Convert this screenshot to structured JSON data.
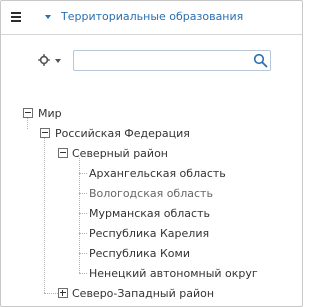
{
  "header": {
    "title": "Территориальные образования",
    "menu_icon": "hamburger-menu-icon",
    "dropdown_icon": "caret-down-icon"
  },
  "toolbar": {
    "settings_icon": "gear-icon",
    "search": {
      "value": "",
      "placeholder": "",
      "icon": "search-icon"
    }
  },
  "colors": {
    "accent": "#2a6fb0",
    "border": "#c8c8c8",
    "search_border": "#b7c7d8"
  },
  "tree": {
    "root": {
      "label": "Мир",
      "expanded": true
    },
    "country": {
      "label": "Российская Федерация",
      "expanded": true
    },
    "district1": {
      "label": "Северный район",
      "expanded": true,
      "children": [
        {
          "label": "Архангельская область"
        },
        {
          "label": "Вологодская область"
        },
        {
          "label": "Мурманская область"
        },
        {
          "label": "Республика Карелия"
        },
        {
          "label": "Республика Коми"
        },
        {
          "label": "Ненецкий автономный округ"
        }
      ]
    },
    "district2": {
      "label": "Северо-Западный район",
      "expanded": false
    }
  }
}
